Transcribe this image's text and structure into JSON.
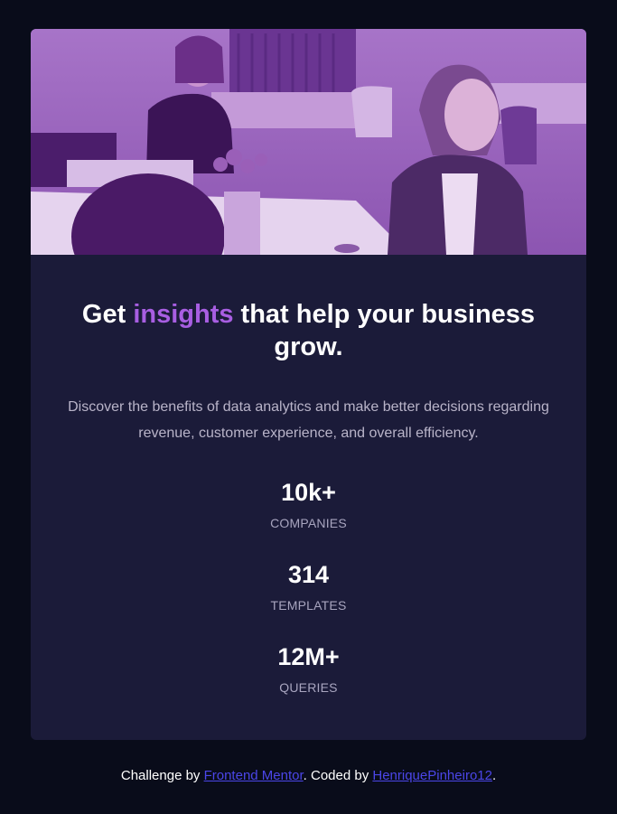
{
  "hero_image": {
    "alt": "",
    "tint_color": "#8e5bb8"
  },
  "headline": {
    "before": "Get ",
    "accent": "insights",
    "after": " that help your business grow."
  },
  "description": "Discover the benefits of data analytics and make better decisions regarding revenue, customer experience, and overall efficiency.",
  "stats": [
    {
      "value": "10k+",
      "label": "COMPANIES"
    },
    {
      "value": "314",
      "label": "TEMPLATES"
    },
    {
      "value": "12M+",
      "label": "QUERIES"
    }
  ],
  "footer": {
    "prefix": "Challenge by ",
    "link1": "Frontend Mentor",
    "middle": ". Coded by ",
    "link2": "HenriquePinheiro12",
    "suffix": "."
  },
  "colors": {
    "background": "#090c1a",
    "card": "#1b1b39",
    "accent": "#a85ee2",
    "link": "#4b46e8"
  }
}
